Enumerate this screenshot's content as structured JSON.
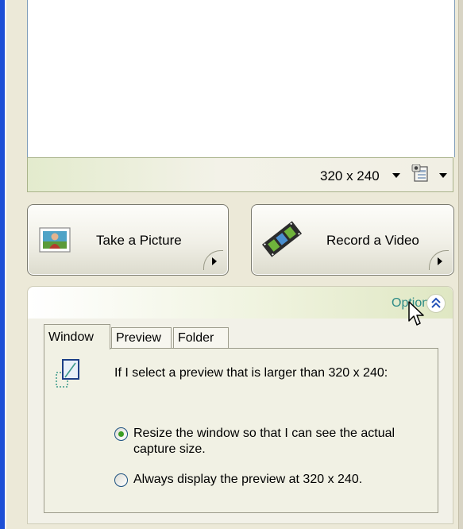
{
  "preview": {
    "resolution": "320 x 240",
    "resolution_dropdown_icon": "chevron-down-icon",
    "camera_menu_icon": "camera-settings-icon"
  },
  "buttons": {
    "take_picture": "Take a Picture",
    "record_video": "Record a Video"
  },
  "options": {
    "label": "Options",
    "collapse_icon": "double-chevron-up-icon",
    "tabs": [
      {
        "label": "Window",
        "selected": true
      },
      {
        "label": "Preview",
        "selected": false
      },
      {
        "label": "Folder",
        "selected": false
      }
    ],
    "window_tab": {
      "description": "If I select a preview that is larger than 320 x 240:",
      "radio_options": [
        {
          "label": "Resize the window so that I can see the actual capture size.",
          "checked": true
        },
        {
          "label": "Always display the preview at 320 x 240.",
          "checked": false
        }
      ]
    }
  },
  "colors": {
    "options_text": "#2c8a86",
    "window_accent": "#1d4fd6",
    "radio_dot": "#3a9d23"
  }
}
